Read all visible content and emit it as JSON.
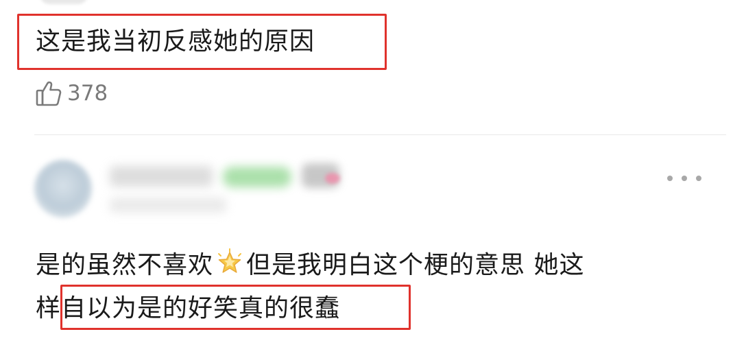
{
  "comment1": {
    "text": "这是我当初反感她的原因",
    "like_icon": "thumbs-up-icon",
    "like_count": "378"
  },
  "comment2": {
    "line1_before_emoji": "是的虽然不喜欢",
    "emoji": "glowing-star-emoji",
    "line1_after_emoji": "但是我明白这个梗的意思 她这",
    "line2_prefix": "样",
    "line2_highlighted": "自以为是的好笑真的很蠢",
    "more_icon": "more-options-icon"
  },
  "colors": {
    "highlight_border": "#e0322c",
    "like_gray": "#7a7a7a",
    "dots_gray": "#a8a8a8"
  }
}
